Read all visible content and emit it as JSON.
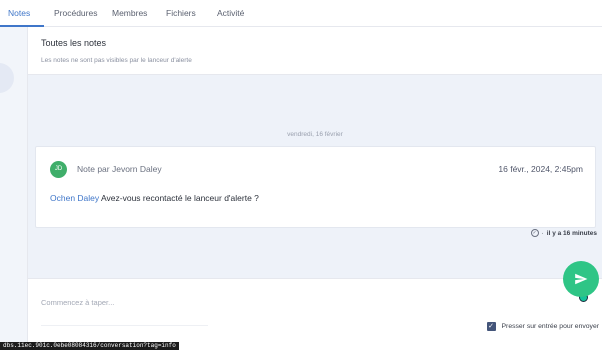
{
  "tabs": [
    {
      "label": "Notes",
      "active": true
    },
    {
      "label": "Procédures",
      "active": false
    },
    {
      "label": "Membres",
      "active": false
    },
    {
      "label": "Fichiers",
      "active": false
    },
    {
      "label": "Activité",
      "active": false
    }
  ],
  "header": {
    "title": "Toutes les notes",
    "subtitle": "Les notes ne sont pas visibles par le lanceur d'alerte"
  },
  "date_separator": "vendredi, 16 février",
  "note": {
    "avatar_initials": "JD",
    "avatar_color": "#3fae6a",
    "author": "Note par Jevorn Daley",
    "date": "16 févr., 2024, 2:45pm",
    "mention": "Ochen Daley",
    "text": " Avez-vous recontacté le lanceur d'alerte ?"
  },
  "meta": {
    "status_icon": "check-circle-icon",
    "separator": "·",
    "relative_time": "il y a 16 minutes"
  },
  "composer": {
    "placeholder": "Commencez à taper...",
    "value": "",
    "enter_to_send_label": "Presser sur entrée pour envoyer",
    "enter_to_send_checked": true
  },
  "send_button": {
    "icon": "send-icon",
    "color": "#2fc586"
  },
  "status_bar_url": "dbs.11ec.901c.0ebe08084316/conversation?tag=info"
}
